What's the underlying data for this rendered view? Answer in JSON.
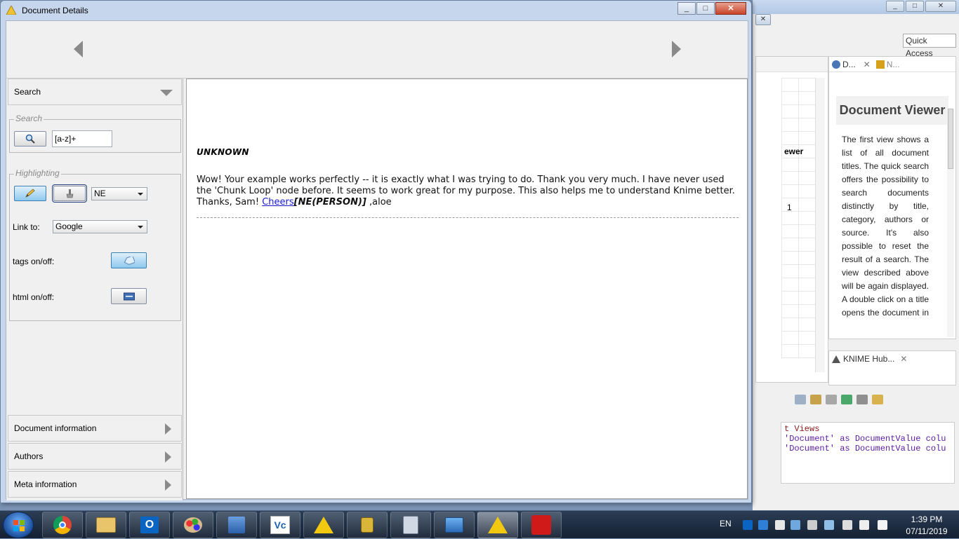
{
  "dialog": {
    "title": "Document Details",
    "minimize": "_",
    "maximize": "□",
    "close": "✕"
  },
  "search_section": {
    "header": "Search",
    "group_label": "Search",
    "input_value": "[a-z]+"
  },
  "highlighting": {
    "group_label": "Highlighting",
    "tag_type": "NE",
    "link_to_label": "Link to:",
    "link_to_value": "Google",
    "tags_label": "tags on/off:",
    "html_label": "html on/off:"
  },
  "accordion": {
    "document_information": "Document information",
    "authors": "Authors",
    "meta_information": "Meta information"
  },
  "document": {
    "category": "UNKNOWN",
    "text_before_link": "Wow! Your example works perfectly -- it is exactly what I was trying to do. Thank you very much. I have never used the 'Chunk Loop' node before. It seems to work great for my purpose. This also helps me to understand Knime better. Thanks, Sam! ",
    "link_text": "Cheers",
    "tag_text": "[NE(PERSON)]",
    "text_after_tag": " ,aloe"
  },
  "background_app": {
    "quick_access": "Quick Access",
    "viewer_fragment": "ewer",
    "number_fragment": "1",
    "doc_viewer_tab": "D...",
    "node_tab": "N...",
    "doc_viewer_heading": "Document Viewer",
    "doc_viewer_body": "The first view shows a list of all document titles. The quick search offers the possibility to search documents distinctly by title, category, authors or source. It's also possible to reset the result of a search. The view described above will be again displayed. A double click on a title opens the document in detail",
    "hub_tab": "KNIME Hub...",
    "console_line1": "t Views",
    "console_line2": "'Document' as DocumentValue colu",
    "console_line3": "'Document' as DocumentValue colu"
  },
  "taskbar": {
    "language": "EN",
    "time": "1:39 PM",
    "date": "07/11/2019",
    "apps": [
      "chrome-icon",
      "file-explorer-icon",
      "outlook-icon",
      "paint-icon",
      "network-icon",
      "vnc-viewer-icon",
      "knime-icon",
      "keepass-icon",
      "calculator-icon",
      "remote-desktop-icon",
      "knime-icon",
      "acrobat-icon"
    ]
  },
  "colors": {
    "titlebar": "#c6d6ec",
    "link": "#1a1acc",
    "taskbar": "#1a2a40",
    "highlight_button": "#8fc8ee"
  }
}
